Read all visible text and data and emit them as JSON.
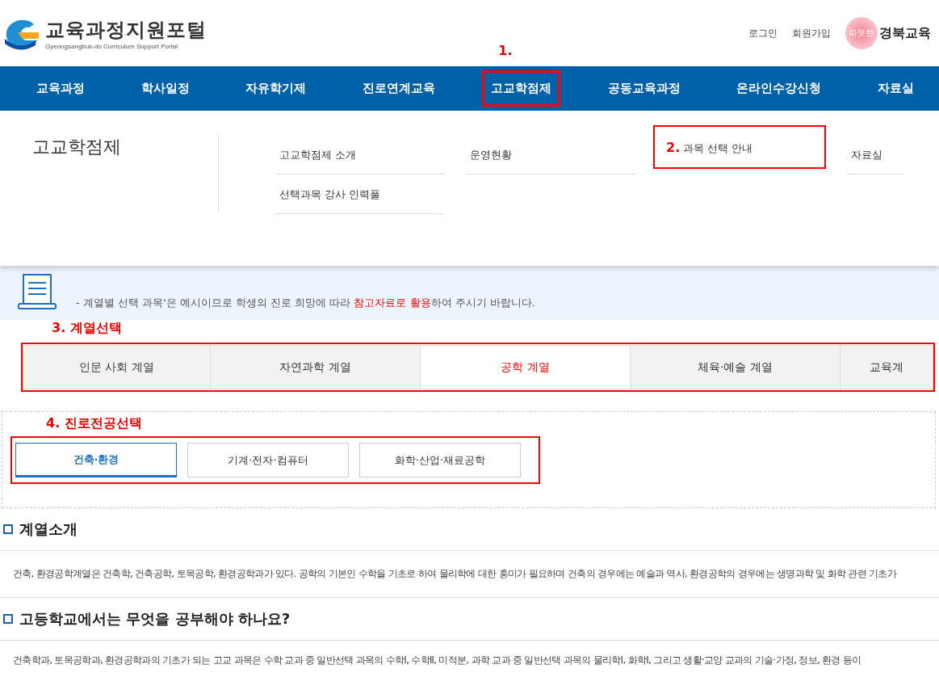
{
  "header": {
    "logo_title": "교육과정지원포털",
    "logo_subtitle": "Gyeongsangbuk-do Curriculum Support Portal",
    "links": [
      "로그인",
      "회원가입"
    ],
    "brand_small": "따뜻한",
    "brand": "경북교육"
  },
  "nav": [
    {
      "label": "교육과정",
      "selected": false
    },
    {
      "label": "학사일정",
      "selected": false
    },
    {
      "label": "자유학기제",
      "selected": false
    },
    {
      "label": "진로연계교육",
      "selected": false
    },
    {
      "label": "고교학점제",
      "selected": true,
      "callout": "1."
    },
    {
      "label": "공동교육과정",
      "selected": false
    },
    {
      "label": "온라인수강신청",
      "selected": false
    },
    {
      "label": "자료실",
      "selected": false
    }
  ],
  "dropdown": {
    "title": "고교학점제",
    "columns": [
      {
        "items": [
          {
            "label": "고교학점제 소개",
            "selected": false
          },
          {
            "label": "선택과목 강사 인력풀",
            "selected": false
          }
        ]
      },
      {
        "items": [
          {
            "label": "운영현황",
            "selected": false
          }
        ]
      },
      {
        "items": [
          {
            "label": "과목 선택 안내",
            "selected": true,
            "callout": "2."
          }
        ]
      },
      {
        "items": [
          {
            "label": "자료실",
            "selected": false
          }
        ]
      }
    ]
  },
  "notice": {
    "text": "- 계열별 선택 과목'은 예시이므로 학생의 진로 희망에 따라 **참고자료로 활용**하여 주시기 바랍니다."
  },
  "step3": "3. 계열선택",
  "tracks": [
    {
      "label": "인문 사회 계열",
      "selected": false
    },
    {
      "label": "자연과학 계열",
      "selected": false
    },
    {
      "label": "공학 계열",
      "selected": true
    },
    {
      "label": "체육·예술 계열",
      "selected": false
    },
    {
      "label": "교육계",
      "selected": false
    }
  ],
  "step4": "4. 진로전공선택",
  "majors": [
    {
      "label": "건축·환경",
      "selected": true
    },
    {
      "label": "기계·전자·컴퓨터",
      "selected": false
    },
    {
      "label": "화학·산업·재료공학",
      "selected": false
    }
  ],
  "sections": [
    {
      "heading": "계열소개",
      "text": "건축, 환경공학계열은 건축학, 건축공학, 토목공학, 환경공학과가 있다. 공학의 기본인 수학을 기초로 하여 물리학에 대한 흥미가 필요하며 건축의 경우에는 예술과 역사, 환경공학의 경우에는 생명과학 및 화학 관련 기초가"
    },
    {
      "heading": "고등학교에서는 무엇을 공부해야 하나요?",
      "text": "건축학과, 토목공학과, 환경공학과의 기초가 되는 고교 과목은 수학 교과 중 일반선택 과목의 수학Ⅰ, 수학Ⅱ, 미적분, 과학 교과 중 일반선택 과목의 물리학Ⅰ, 화학Ⅰ, 그리고 생활·교양 교과의 기술·가정, 정보, 환경 등이"
    }
  ]
}
